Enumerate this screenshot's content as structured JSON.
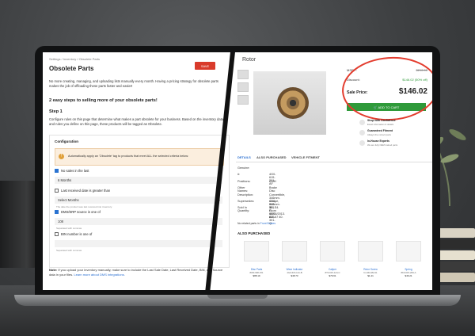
{
  "left": {
    "breadcrumb": "Settings  /  Inventory  /  Obsolete Parts",
    "title": "Obsolete Parts",
    "save_label": "SAVE",
    "intro": "No more creating, managing, and uploading lists manually every month. Having a pricing strategy for obsolete parts makes the job of offloading these parts faster and easier!",
    "heading2": "2 easy steps to selling more of your obsolete parts!",
    "heading3": "Step 1",
    "step_text": "Configure rules on this page that determine what makes a part obsolete for your business. Based on the inventory data and rules you define on this page, these products will be tagged as Obsolete.",
    "config": {
      "header": "Configuration",
      "warning": "Automatically apply an 'Obsolete' tag to products that meet ALL the selected criteria below:",
      "no_sales_label": "No sales in the last",
      "no_sales_value": "6 Months",
      "last_received_label": "Last received date is greater than",
      "select_months": "Select Months",
      "hint_received": "The date the product was last received into inventory.",
      "source_label": "DMS/ERP source is one of",
      "source_value": "108",
      "hint_source": "Separated with commas",
      "bin_label": "BIN number is one of",
      "hint_bin": "Separated with commas"
    },
    "note_bold": "Note:",
    "note_text": " If you upload your inventory manually, make sure to include the Last Sale Date, Last Received Date, BIN, and Source data in your files. ",
    "note_link": "Learn more about DMS integrations."
  },
  "right": {
    "title": "Rotor",
    "msrp_label": "MSRP:",
    "msrp_value": "$292.05",
    "discount_label": "Discount:",
    "discount_value": "$146.02 (50% off)",
    "sale_label": "Sale Price:",
    "sale_value": "$146.02",
    "cart_label": "ADD TO CART",
    "features": [
      {
        "title": "Shop with Confidence",
        "sub": "Exact information & details"
      },
      {
        "title": "Guaranteed Fitment",
        "sub": "Always the correct parts"
      },
      {
        "title": "In-House Experts",
        "sub": "We are fully OEM trained parts"
      }
    ],
    "tabs": [
      "DETAILS",
      "ALSO PURCHASED",
      "VEHICLE FITMENT"
    ],
    "specs": [
      {
        "k": "Genuine:",
        "v": ""
      },
      {
        "k": "#:",
        "v": "4G0-615-301-AF"
      },
      {
        "k": "Positions:",
        "v": "LH/H"
      },
      {
        "k": "Other Names:",
        "v": "Brake Disc"
      },
      {
        "k": "Description:",
        "v": "Convertible, 346mm. Coupe, 346mm. S5, S4. From 08/05/2013. A6, A7 40."
      },
      {
        "k": "Supersedes:",
        "v": "4G0-615-301-G, 4G0-615-301-Q"
      },
      {
        "k": "Sold In Quantity:",
        "v": "1"
      }
    ],
    "link_prefix": "No related parts in ",
    "link_text": "Front Brakes",
    "also_heading": "ALSO PURCHASED",
    "products": [
      {
        "name": "Disc Pads",
        "sku": "8W0-698-151",
        "price": "$88.19"
      },
      {
        "name": "Wear Indicator",
        "sku": "4G0-615-121-B",
        "price": "$48.73"
      },
      {
        "name": "Caliper",
        "sku": "8T0-615-124-C",
        "price": "$79.61"
      },
      {
        "name": "Rotor Screw",
        "sku": "N-106-482-01",
        "price": "$1.41"
      },
      {
        "name": "Spring",
        "sku": "8K0-615-269-A",
        "price": "$46.21"
      }
    ]
  }
}
